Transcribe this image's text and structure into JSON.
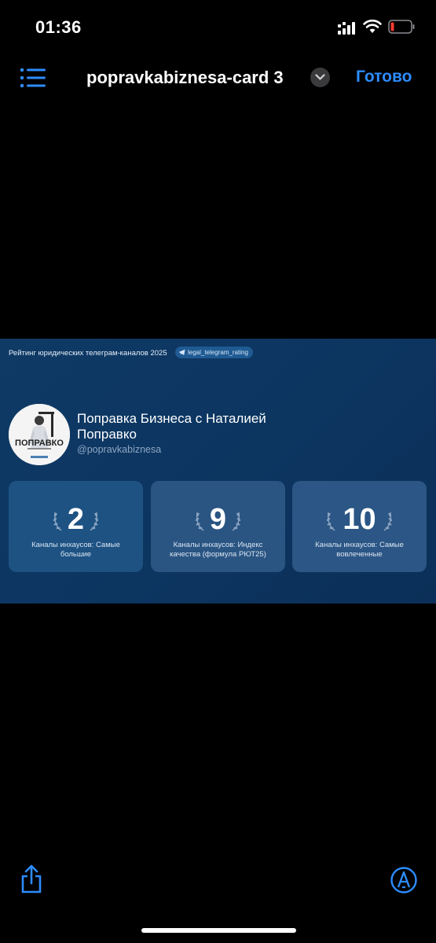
{
  "status_bar": {
    "time": "01:36"
  },
  "nav": {
    "title": "popravkabiznesa-card 3",
    "done_label": "Готово"
  },
  "card": {
    "heading": "Рейтинг юридических телеграм-каналов 2025",
    "tag": "legal_telegram_rating",
    "avatar_text": "ПОПРАВКО",
    "channel_name": "Поправка Бизнеса с Наталией Поправко",
    "channel_handle": "@popravkabiznesa",
    "stats": [
      {
        "value": "2",
        "label": "Каналы инхаусов: Самые большие"
      },
      {
        "value": "9",
        "label": "Каналы инхаусов: Индекс качества (формула РЮТ25)"
      },
      {
        "value": "10",
        "label": "Каналы инхаусов: Самые вовлеченные"
      }
    ]
  },
  "colors": {
    "accent": "#2d8cff",
    "card_background": "#0c3560",
    "stat_background": "#2a5583"
  }
}
